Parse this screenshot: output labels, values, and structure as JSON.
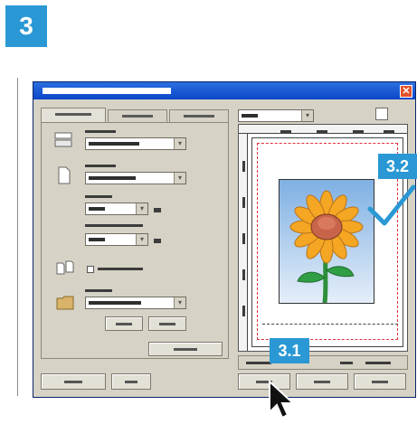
{
  "step_number": "3",
  "callouts": {
    "preview": "3.2",
    "ok_button": "3.1"
  },
  "dialog": {
    "close_glyph": "✕",
    "tabs": [
      "",
      "",
      ""
    ],
    "settings_rows": [
      {
        "icon": "paper-tray-icon"
      },
      {
        "icon": "page-icon"
      },
      {
        "icon": "duplex-icon"
      },
      {
        "icon": "folder-icon"
      }
    ],
    "checkmark_color": "#2a98d4",
    "accent_color": "#2a98d4",
    "preview_margin_color": "#e0303a"
  }
}
